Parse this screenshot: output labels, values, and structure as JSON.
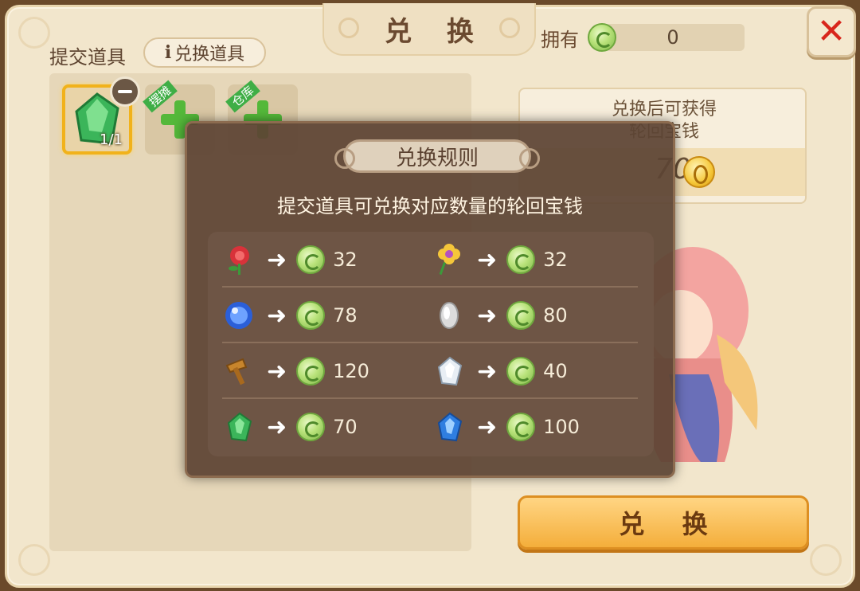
{
  "header": {
    "title": "兑 换",
    "owned_label": "拥有",
    "owned_value": "0"
  },
  "left": {
    "submit_label": "提交道具",
    "info_button_label": "兑换道具",
    "slots": [
      {
        "qty": "1/1",
        "item": "green-crystal-icon"
      },
      {
        "ribbon": "摆摊"
      },
      {
        "ribbon": "仓库"
      }
    ]
  },
  "reward": {
    "title": "兑换后可获得\n轮回宝钱",
    "amount": "70"
  },
  "exchange_button": "兑 换",
  "popup": {
    "title": "兑换规则",
    "description": "提交道具可兑换对应数量的轮回宝钱",
    "rules": [
      {
        "left": {
          "icon": "red-rose-icon",
          "value": "32"
        },
        "right": {
          "icon": "yellow-flower-icon",
          "value": "32"
        }
      },
      {
        "left": {
          "icon": "blue-orb-icon",
          "value": "78"
        },
        "right": {
          "icon": "silver-leaf-icon",
          "value": "80"
        }
      },
      {
        "left": {
          "icon": "bronze-hammer-icon",
          "value": "120"
        },
        "right": {
          "icon": "white-crystal-icon",
          "value": "40"
        }
      },
      {
        "left": {
          "icon": "green-crystal-icon",
          "value": "70"
        },
        "right": {
          "icon": "blue-crystal-icon",
          "value": "100"
        }
      }
    ]
  },
  "colors": {
    "parchment": "#f2e6cc",
    "popup_bg": "#5c4434",
    "accent_orange": "#f4ae3b",
    "close_red": "#d8261c",
    "coin_green": "#b9e27a"
  }
}
